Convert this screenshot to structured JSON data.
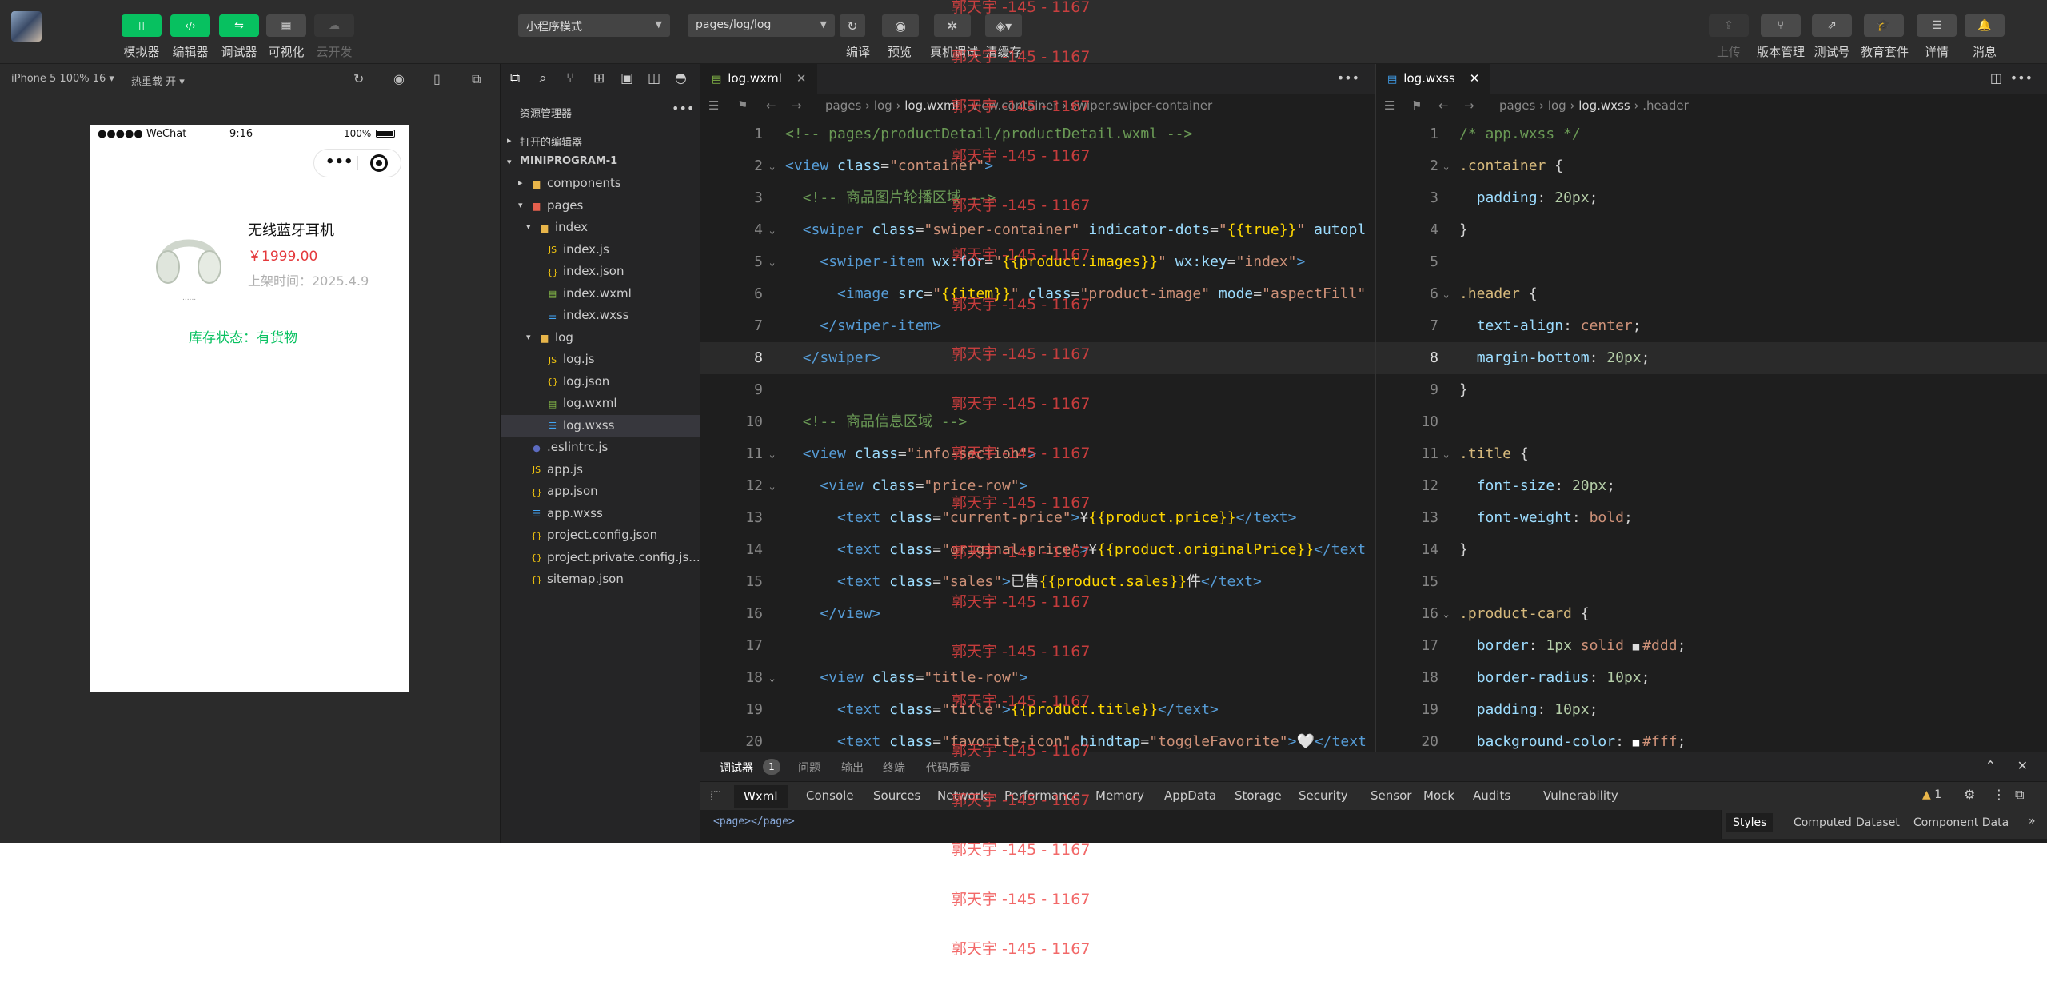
{
  "toolbar": {
    "left_buttons": [
      {
        "label": "模拟器",
        "icon": "phone-icon",
        "style": "green"
      },
      {
        "label": "编辑器",
        "icon": "code-icon",
        "style": "green"
      },
      {
        "label": "调试器",
        "icon": "debug-icon",
        "style": "green"
      },
      {
        "label": "可视化",
        "icon": "layout-icon",
        "style": "gray"
      },
      {
        "label": "云开发",
        "icon": "cloud-icon",
        "style": "dim"
      }
    ],
    "mode_select": "小程序模式",
    "page_select": "pages/log/log",
    "center_labels": [
      "编译",
      "预览",
      "真机调试",
      "清缓存"
    ],
    "right_buttons": [
      {
        "label": "上传",
        "icon": "upload-icon"
      },
      {
        "label": "版本管理",
        "icon": "branch-icon"
      },
      {
        "label": "测试号",
        "icon": "external-link-icon"
      },
      {
        "label": "教育套件",
        "icon": "graduation-icon"
      },
      {
        "label": "详情",
        "icon": "menu-icon"
      },
      {
        "label": "消息",
        "icon": "bell-icon"
      }
    ]
  },
  "simulator": {
    "device": "iPhone 5 100% 16 ▾",
    "hot_reload": "热重载 开 ▾",
    "status_left": "●●●●● WeChat",
    "status_time": "9:16",
    "status_battery": "100%",
    "product_title": "无线蓝牙耳机",
    "product_price": "￥1999.00",
    "product_date": "上架时间：2025.4.9",
    "stock_status": "库存状态：有货物",
    "image_caption": "......"
  },
  "explorer": {
    "title": "资源管理器",
    "open_editors": "打开的编辑器",
    "project": "MINIPROGRAM-1",
    "tree": [
      {
        "label": "components",
        "type": "folder",
        "depth": 1,
        "caret": "▸"
      },
      {
        "label": "pages",
        "type": "folder-red",
        "depth": 1,
        "caret": "▾"
      },
      {
        "label": "index",
        "type": "folder",
        "depth": 2,
        "caret": "▾"
      },
      {
        "label": "index.js",
        "type": "js",
        "depth": 3
      },
      {
        "label": "index.json",
        "type": "json",
        "depth": 3
      },
      {
        "label": "index.wxml",
        "type": "wxml",
        "depth": 3
      },
      {
        "label": "index.wxss",
        "type": "wxss",
        "depth": 3
      },
      {
        "label": "log",
        "type": "folder",
        "depth": 2,
        "caret": "▾"
      },
      {
        "label": "log.js",
        "type": "js",
        "depth": 3
      },
      {
        "label": "log.json",
        "type": "json",
        "depth": 3
      },
      {
        "label": "log.wxml",
        "type": "wxml",
        "depth": 3
      },
      {
        "label": "log.wxss",
        "type": "wxss",
        "depth": 3,
        "selected": true
      },
      {
        "label": ".eslintrc.js",
        "type": "eslint",
        "depth": 1
      },
      {
        "label": "app.js",
        "type": "js",
        "depth": 1
      },
      {
        "label": "app.json",
        "type": "json",
        "depth": 1
      },
      {
        "label": "app.wxss",
        "type": "wxss",
        "depth": 1
      },
      {
        "label": "project.config.json",
        "type": "json",
        "depth": 1
      },
      {
        "label": "project.private.config.js...",
        "type": "json",
        "depth": 1
      },
      {
        "label": "sitemap.json",
        "type": "json",
        "depth": 1
      }
    ]
  },
  "editor_left": {
    "tab": "log.wxml",
    "breadcrumb": [
      "pages",
      "log",
      "log.wxml",
      "view.container",
      "swiper.swiper-container"
    ],
    "lines": [
      [
        [
          "c-com",
          "<!-- pages/productDetail/productDetail.wxml -->"
        ]
      ],
      [
        [
          "c-tag",
          "<view "
        ],
        [
          "c-attr",
          "class"
        ],
        [
          "c-brk",
          "="
        ],
        [
          "c-str",
          "\"container\""
        ],
        [
          "c-tag",
          ">"
        ]
      ],
      [
        [
          "c-txt",
          "  "
        ],
        [
          "c-com",
          "<!-- 商品图片轮播区域 -->"
        ]
      ],
      [
        [
          "c-txt",
          "  "
        ],
        [
          "c-tag",
          "<swiper "
        ],
        [
          "c-attr",
          "class"
        ],
        [
          "c-brk",
          "="
        ],
        [
          "c-str",
          "\"swiper-container\""
        ],
        [
          "c-attr",
          " indicator-dots"
        ],
        [
          "c-brk",
          "="
        ],
        [
          "c-str",
          "\""
        ],
        [
          "c-yel",
          "{{true}}"
        ],
        [
          "c-str",
          "\""
        ],
        [
          "c-attr",
          " autopl"
        ]
      ],
      [
        [
          "c-txt",
          "    "
        ],
        [
          "c-tag",
          "<swiper-item "
        ],
        [
          "c-attr",
          "wx:for"
        ],
        [
          "c-brk",
          "="
        ],
        [
          "c-str",
          "\""
        ],
        [
          "c-yel",
          "{{product.images}}"
        ],
        [
          "c-str",
          "\""
        ],
        [
          "c-attr",
          " wx:key"
        ],
        [
          "c-brk",
          "="
        ],
        [
          "c-str",
          "\"index\""
        ],
        [
          "c-tag",
          ">"
        ]
      ],
      [
        [
          "c-txt",
          "      "
        ],
        [
          "c-tag",
          "<image "
        ],
        [
          "c-attr",
          "src"
        ],
        [
          "c-brk",
          "="
        ],
        [
          "c-str",
          "\""
        ],
        [
          "c-yel",
          "{{item}}"
        ],
        [
          "c-str",
          "\""
        ],
        [
          "c-attr",
          " class"
        ],
        [
          "c-brk",
          "="
        ],
        [
          "c-str",
          "\"product-image\""
        ],
        [
          "c-attr",
          " mode"
        ],
        [
          "c-brk",
          "="
        ],
        [
          "c-str",
          "\"aspectFill\""
        ]
      ],
      [
        [
          "c-txt",
          "    "
        ],
        [
          "c-tag",
          "</swiper-item>"
        ]
      ],
      [
        [
          "c-txt",
          "  "
        ],
        [
          "c-tag",
          "</swiper>"
        ]
      ],
      [],
      [
        [
          "c-txt",
          "  "
        ],
        [
          "c-com",
          "<!-- 商品信息区域 -->"
        ]
      ],
      [
        [
          "c-txt",
          "  "
        ],
        [
          "c-tag",
          "<view "
        ],
        [
          "c-attr",
          "class"
        ],
        [
          "c-brk",
          "="
        ],
        [
          "c-str",
          "\"info-section\""
        ],
        [
          "c-tag",
          ">"
        ]
      ],
      [
        [
          "c-txt",
          "    "
        ],
        [
          "c-tag",
          "<view "
        ],
        [
          "c-attr",
          "class"
        ],
        [
          "c-brk",
          "="
        ],
        [
          "c-str",
          "\"price-row\""
        ],
        [
          "c-tag",
          ">"
        ]
      ],
      [
        [
          "c-txt",
          "      "
        ],
        [
          "c-tag",
          "<text "
        ],
        [
          "c-attr",
          "class"
        ],
        [
          "c-brk",
          "="
        ],
        [
          "c-str",
          "\"current-price\""
        ],
        [
          "c-tag",
          ">"
        ],
        [
          "c-txt",
          "¥"
        ],
        [
          "c-yel",
          "{{product.price}}"
        ],
        [
          "c-tag",
          "</text>"
        ]
      ],
      [
        [
          "c-txt",
          "      "
        ],
        [
          "c-tag",
          "<text "
        ],
        [
          "c-attr",
          "class"
        ],
        [
          "c-brk",
          "="
        ],
        [
          "c-str",
          "\"original-price\""
        ],
        [
          "c-tag",
          ">"
        ],
        [
          "c-txt",
          "¥"
        ],
        [
          "c-yel",
          "{{product.originalPrice}}"
        ],
        [
          "c-tag",
          "</text"
        ]
      ],
      [
        [
          "c-txt",
          "      "
        ],
        [
          "c-tag",
          "<text "
        ],
        [
          "c-attr",
          "class"
        ],
        [
          "c-brk",
          "="
        ],
        [
          "c-str",
          "\"sales\""
        ],
        [
          "c-tag",
          ">"
        ],
        [
          "c-txt",
          "已售"
        ],
        [
          "c-yel",
          "{{product.sales}}"
        ],
        [
          "c-txt",
          "件"
        ],
        [
          "c-tag",
          "</text>"
        ]
      ],
      [
        [
          "c-txt",
          "    "
        ],
        [
          "c-tag",
          "</view>"
        ]
      ],
      [],
      [
        [
          "c-txt",
          "    "
        ],
        [
          "c-tag",
          "<view "
        ],
        [
          "c-attr",
          "class"
        ],
        [
          "c-brk",
          "="
        ],
        [
          "c-str",
          "\"title-row\""
        ],
        [
          "c-tag",
          ">"
        ]
      ],
      [
        [
          "c-txt",
          "      "
        ],
        [
          "c-tag",
          "<text "
        ],
        [
          "c-attr",
          "class"
        ],
        [
          "c-brk",
          "="
        ],
        [
          "c-str",
          "\"title\""
        ],
        [
          "c-tag",
          ">"
        ],
        [
          "c-yel",
          "{{product.title}}"
        ],
        [
          "c-tag",
          "</text>"
        ]
      ],
      [
        [
          "c-txt",
          "      "
        ],
        [
          "c-tag",
          "<text "
        ],
        [
          "c-attr",
          "class"
        ],
        [
          "c-brk",
          "="
        ],
        [
          "c-str",
          "\"favorite-icon\""
        ],
        [
          "c-attr",
          " bindtap"
        ],
        [
          "c-brk",
          "="
        ],
        [
          "c-str",
          "\"toggleFavorite\""
        ],
        [
          "c-tag",
          ">"
        ],
        [
          "c-txt",
          "🤍"
        ],
        [
          "c-tag",
          "</text"
        ]
      ]
    ]
  },
  "editor_right": {
    "tab": "log.wxss",
    "breadcrumb": [
      "pages",
      "log",
      "log.wxss",
      ".header"
    ],
    "lines": [
      [
        [
          "c-com",
          "/* app.wxss */"
        ]
      ],
      [
        [
          "c-sel",
          ".container"
        ],
        [
          "c-txt",
          " {"
        ]
      ],
      [
        [
          "c-txt",
          "  "
        ],
        [
          "c-prop",
          "padding"
        ],
        [
          "c-txt",
          ": "
        ],
        [
          "c-num",
          "20px"
        ],
        [
          "c-txt",
          ";"
        ]
      ],
      [
        [
          "c-txt",
          "}"
        ]
      ],
      [],
      [
        [
          "c-sel",
          ".header"
        ],
        [
          "c-txt",
          " {"
        ]
      ],
      [
        [
          "c-txt",
          "  "
        ],
        [
          "c-prop",
          "text-align"
        ],
        [
          "c-txt",
          ": "
        ],
        [
          "c-val",
          "center"
        ],
        [
          "c-txt",
          ";"
        ]
      ],
      [
        [
          "c-txt",
          "  "
        ],
        [
          "c-prop",
          "margin-bottom"
        ],
        [
          "c-txt",
          ": "
        ],
        [
          "c-num",
          "20px"
        ],
        [
          "c-txt",
          ";"
        ]
      ],
      [
        [
          "c-txt",
          "}"
        ]
      ],
      [],
      [
        [
          "c-sel",
          ".title"
        ],
        [
          "c-txt",
          " {"
        ]
      ],
      [
        [
          "c-txt",
          "  "
        ],
        [
          "c-prop",
          "font-size"
        ],
        [
          "c-txt",
          ": "
        ],
        [
          "c-num",
          "20px"
        ],
        [
          "c-txt",
          ";"
        ]
      ],
      [
        [
          "c-txt",
          "  "
        ],
        [
          "c-prop",
          "font-weight"
        ],
        [
          "c-txt",
          ": "
        ],
        [
          "c-val",
          "bold"
        ],
        [
          "c-txt",
          ";"
        ]
      ],
      [
        [
          "c-txt",
          "}"
        ]
      ],
      [],
      [
        [
          "c-sel",
          ".product-card"
        ],
        [
          "c-txt",
          " {"
        ]
      ],
      [
        [
          "c-txt",
          "  "
        ],
        [
          "c-prop",
          "border"
        ],
        [
          "c-txt",
          ": "
        ],
        [
          "c-num",
          "1px"
        ],
        [
          "c-val",
          " solid "
        ],
        [
          "swatch-ddd",
          "■"
        ],
        [
          "c-val",
          "#ddd"
        ],
        [
          "c-txt",
          ";"
        ]
      ],
      [
        [
          "c-txt",
          "  "
        ],
        [
          "c-prop",
          "border-radius"
        ],
        [
          "c-txt",
          ": "
        ],
        [
          "c-num",
          "10px"
        ],
        [
          "c-txt",
          ";"
        ]
      ],
      [
        [
          "c-txt",
          "  "
        ],
        [
          "c-prop",
          "padding"
        ],
        [
          "c-txt",
          ": "
        ],
        [
          "c-num",
          "10px"
        ],
        [
          "c-txt",
          ";"
        ]
      ],
      [
        [
          "c-txt",
          "  "
        ],
        [
          "c-prop",
          "background-color"
        ],
        [
          "c-txt",
          ": "
        ],
        [
          "swatch-fff",
          "■"
        ],
        [
          "c-val",
          "#fff"
        ],
        [
          "c-txt",
          ";"
        ]
      ]
    ]
  },
  "active_line": 8,
  "debugger": {
    "title": "调试器",
    "badge": "1",
    "head_tabs": [
      "问题",
      "输出",
      "终端",
      "代码质量"
    ],
    "tabs": [
      "Wxml",
      "Console",
      "Sources",
      "Network",
      "Performance",
      "Memory",
      "AppData",
      "Storage",
      "Security",
      "Sensor",
      "Mock",
      "Audits",
      "Vulnerability"
    ],
    "warning_count": "1",
    "dom_preview": "<page></page>",
    "side_tabs": [
      "Styles",
      "Computed",
      "Dataset",
      "Component Data"
    ]
  },
  "watermark_text": "郭天宇 -145 - 1167",
  "colors": {
    "accent_green": "#07c160",
    "price_red": "#e4393c",
    "stock_green": "#07c160",
    "watermark": "#ef4444"
  }
}
